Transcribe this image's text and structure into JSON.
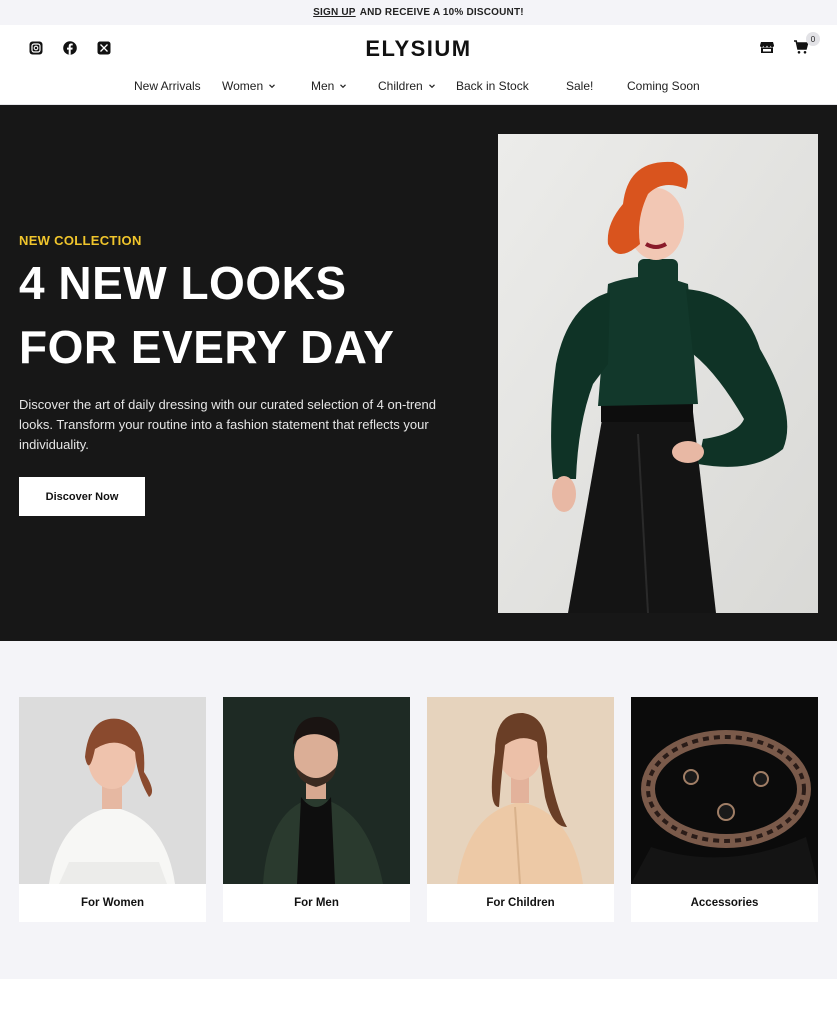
{
  "announcement": {
    "link": "SIGN UP",
    "text": "AND RECEIVE A 10% DISCOUNT!"
  },
  "header": {
    "logo": "ELYSIUM",
    "social_icons": [
      "instagram-icon",
      "facebook-icon",
      "x-icon"
    ],
    "store_icon": "store-icon",
    "cart_icon": "cart-icon",
    "cart_count": "0"
  },
  "nav": {
    "items": [
      {
        "label": "New Arrivals",
        "has_dropdown": false
      },
      {
        "label": "Women",
        "has_dropdown": true
      },
      {
        "label": "Men",
        "has_dropdown": true
      },
      {
        "label": "Children",
        "has_dropdown": true
      },
      {
        "label": "Back in Stock",
        "has_dropdown": false
      },
      {
        "label": "Sale!",
        "has_dropdown": false
      },
      {
        "label": "Coming Soon",
        "has_dropdown": false
      }
    ]
  },
  "hero": {
    "eyebrow": "NEW COLLECTION",
    "title_line1": "4 NEW LOOKS",
    "title_line2": "FOR EVERY DAY",
    "description": "Discover the art of daily dressing with our curated selection of 4 on-trend looks. Transform your routine into a fashion statement that reflects your individuality.",
    "button": "Discover Now"
  },
  "categories": [
    {
      "label": "For Women"
    },
    {
      "label": "For Men"
    },
    {
      "label": "For Children"
    },
    {
      "label": "Accessories"
    }
  ],
  "colors": {
    "accent": "#f0c52c",
    "hero_bg": "#171717",
    "section_bg": "#f4f4f8"
  }
}
